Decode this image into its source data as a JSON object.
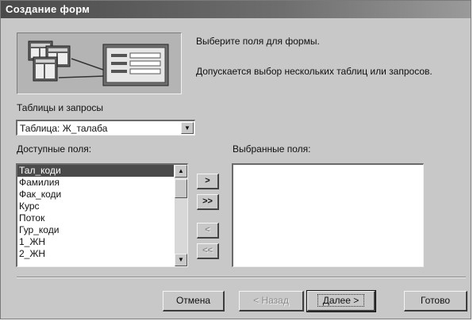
{
  "window": {
    "title": "Создание форм"
  },
  "intro": {
    "heading": "Выберите поля для формы.",
    "description": "Допускается выбор нескольких таблиц или запросов."
  },
  "tables": {
    "label": "Таблицы и запросы",
    "selected": "Таблица: Ж_талаба"
  },
  "available": {
    "label": "Доступные поля:",
    "items": [
      "Тал_коди",
      "Фамилия",
      "Фак_коди",
      "Курс",
      "Поток",
      "Гур_коди",
      "1_ЖН",
      "2_ЖН"
    ],
    "selected_index": 0
  },
  "selected_fields": {
    "label": "Выбранные поля:",
    "items": []
  },
  "move_buttons": {
    "add_one": ">",
    "add_all": ">>",
    "remove_one": "<",
    "remove_all": "<<"
  },
  "footer": {
    "cancel": "Отмена",
    "back": "< Назад",
    "next": "Далее >",
    "finish": "Готово"
  },
  "colors": {
    "titlebar": "#4a4a4a",
    "dialog_bg": "#c8c8c8",
    "selection": "#4a4a4a"
  }
}
